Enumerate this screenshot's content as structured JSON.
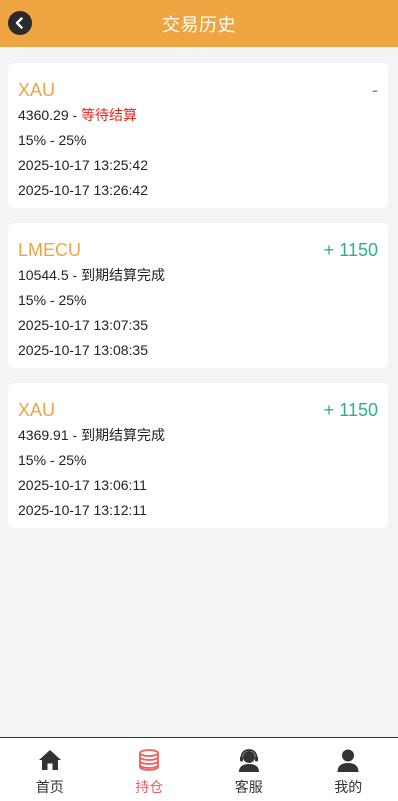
{
  "header": {
    "title": "交易历史"
  },
  "trades": [
    {
      "symbol": "XAU",
      "result": "-",
      "price": "4360.29",
      "separator": " - ",
      "status": "等待结算",
      "status_pending": true,
      "range": "15% - 25%",
      "open_time": "2025-10-17 13:25:42",
      "close_time": "2025-10-17 13:26:42"
    },
    {
      "symbol": "LMECU",
      "result": "+ 1150",
      "price": "10544.5",
      "separator": " - ",
      "status": "到期结算完成",
      "status_pending": false,
      "range": "15% - 25%",
      "open_time": "2025-10-17 13:07:35",
      "close_time": "2025-10-17 13:08:35"
    },
    {
      "symbol": "XAU",
      "result": "+ 1150",
      "price": "4369.91",
      "separator": " - ",
      "status": "到期结算完成",
      "status_pending": false,
      "range": "15% - 25%",
      "open_time": "2025-10-17 13:06:11",
      "close_time": "2025-10-17 13:12:11"
    }
  ],
  "tabbar": {
    "items": [
      {
        "label": "首页",
        "icon": "home-icon"
      },
      {
        "label": "持仓",
        "icon": "coins-icon",
        "active": true
      },
      {
        "label": "客服",
        "icon": "support-icon"
      },
      {
        "label": "我的",
        "icon": "user-icon"
      }
    ]
  },
  "colors": {
    "accent": "#eda441",
    "profit": "#2fae8e",
    "pending": "#e8251e",
    "active_tab": "#f25e5e"
  }
}
